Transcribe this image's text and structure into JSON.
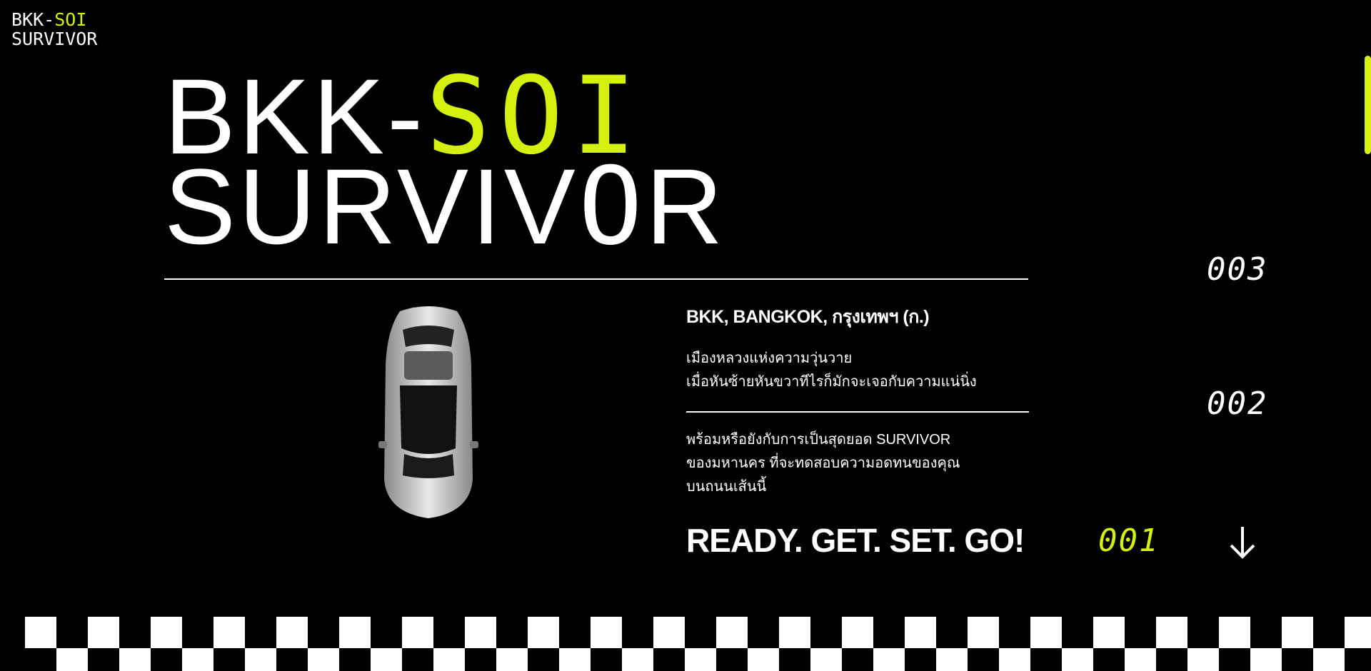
{
  "logo": {
    "part1": "BKK-",
    "part2": "SOI",
    "line2": "SURVIVOR"
  },
  "hero": {
    "part1": "BKK-",
    "part2": "SOI",
    "line2a": "SURVIV",
    "line2b": "O",
    "line2c": "R"
  },
  "info": {
    "location": "BKK, BANGKOK, กรุงเทพฯ (ก.)",
    "desc1": [
      "เมืองหลวงแห่งความวุ่นวาย",
      "เมื่อหันซ้ายหันขวาทีไรก็มักจะเจอกับความแน่นิ่ง"
    ],
    "desc2": [
      "พร้อมหรือยังกับการเป็นสุดยอด SURVIVOR",
      "ของมหานคร ที่จะทดสอบความอดทนของคุณ",
      "บนถนนเส้นนี้"
    ]
  },
  "cta": "READY. GET. SET. GO!",
  "counters": {
    "c3": "003",
    "c2": "002",
    "c1": "001"
  },
  "icons": {
    "arrow": "arrow-down-icon",
    "car": "car-top-view"
  },
  "colors": {
    "accent": "#d4f00f",
    "background": "#000000",
    "text": "#ffffff"
  }
}
